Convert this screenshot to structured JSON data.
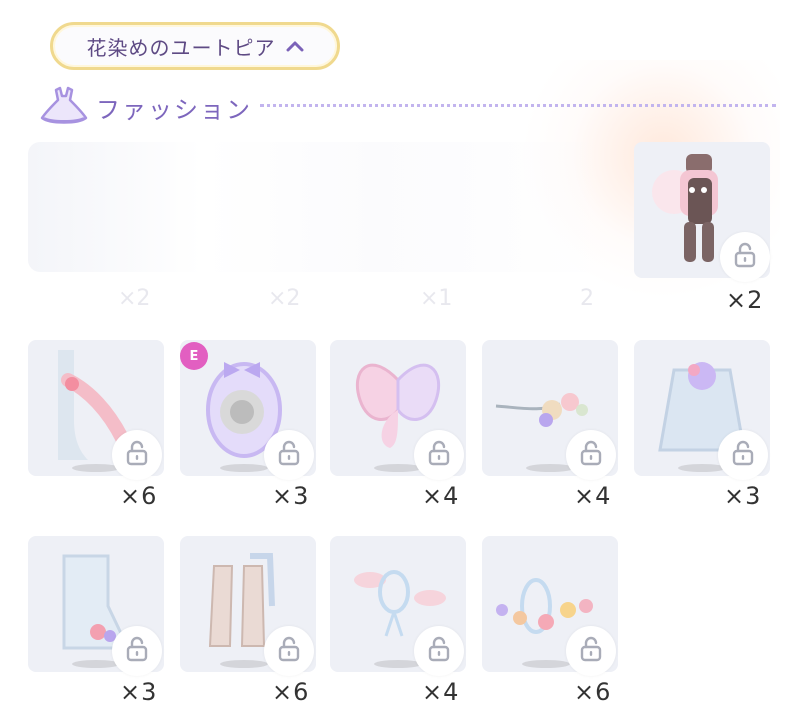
{
  "collection": {
    "name": "花染めのユートピア",
    "chevron": "⌃",
    "chevron_icon": "chevron-up-icon"
  },
  "section": {
    "title": "ファッション",
    "icon": "dress-icon"
  },
  "featured": [
    {
      "qty": "×2",
      "locked": true
    }
  ],
  "items": [
    {
      "qty": "×6",
      "locked": true
    },
    {
      "qty": "×3",
      "locked": true,
      "badge": "E"
    },
    {
      "qty": "×4",
      "locked": true
    },
    {
      "qty": "×4",
      "locked": true
    },
    {
      "qty": "×3",
      "locked": true
    },
    {
      "qty": "×3",
      "locked": true
    },
    {
      "qty": "×6",
      "locked": true
    },
    {
      "qty": "×4",
      "locked": true
    },
    {
      "qty": "×6",
      "locked": true
    }
  ],
  "colors": {
    "accent": "#7d66bd",
    "chip_border": "#f0d98e",
    "badge": "#e25fc1",
    "card_bg": "#eef0f6"
  }
}
